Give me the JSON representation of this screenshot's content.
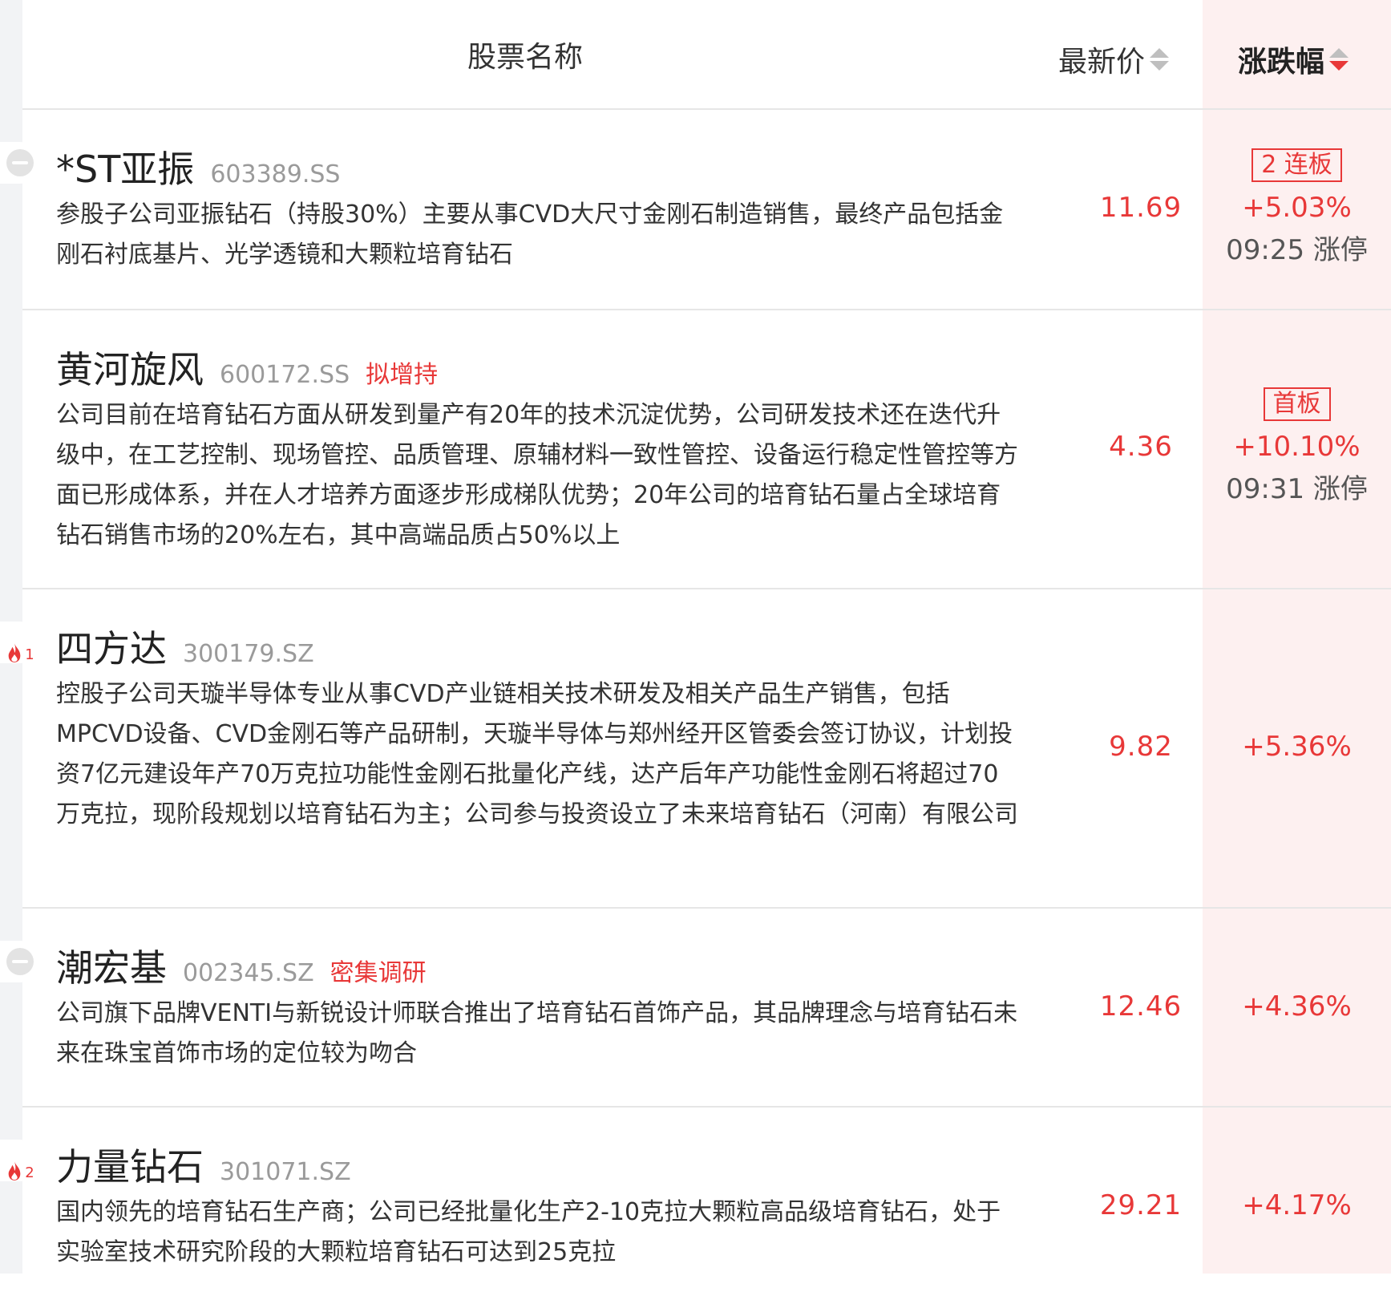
{
  "header": {
    "name_label": "股票名称",
    "price_label": "最新价",
    "pct_label": "涨跌幅",
    "sort_column": "涨跌幅",
    "sort_order": "descending"
  },
  "colors": {
    "up_red": "#e83838",
    "highlight_column_bg": "#fdf0f0",
    "muted_gray": "#9a9a9a"
  },
  "rows": [
    {
      "marker": "minus-icon",
      "name": "*ST亚振",
      "code": "603389.SS",
      "tag": "",
      "desc": "参股子公司亚振钻石（持股30%）主要从事CVD大尺寸金刚石制造销售，最终产品包括金刚石衬底基片、光学透镜和大颗粒培育钻石",
      "price": "11.69",
      "board": "2 连板",
      "pct": "+5.03%",
      "limit_time": "09:25 涨停"
    },
    {
      "marker": "",
      "name": "黄河旋风",
      "code": "600172.SS",
      "tag": "拟增持",
      "desc": "公司目前在培育钻石方面从研发到量产有20年的技术沉淀优势，公司研发技术还在迭代升级中，在工艺控制、现场管控、品质管理、原辅材料一致性管控、设备运行稳定性管控等方面已形成体系，并在人才培养方面逐步形成梯队优势；20年公司的培育钻石量占全球培育钻石销售市场的20%左右，其中高端品质占50%以上",
      "price": "4.36",
      "board": "首板",
      "pct": "+10.10%",
      "limit_time": "09:31 涨停"
    },
    {
      "marker": "fire-icon",
      "hot_rank": "1",
      "name": "四方达",
      "code": "300179.SZ",
      "tag": "",
      "desc": "控股子公司天璇半导体专业从事CVD产业链相关技术研发及相关产品生产销售，包括MPCVD设备、CVD金刚石等产品研制，天璇半导体与郑州经开区管委会签订协议，计划投资7亿元建设年产70万克拉功能性金刚石批量化产线，达产后年产功能性金刚石将超过70万克拉，现阶段规划以培育钻石为主；公司参与投资设立了未来培育钻石（河南）有限公司",
      "price": "9.82",
      "board": "",
      "pct": "+5.36%",
      "limit_time": ""
    },
    {
      "marker": "minus-icon",
      "name": "潮宏基",
      "code": "002345.SZ",
      "tag": "密集调研",
      "desc": "公司旗下品牌VENTI与新锐设计师联合推出了培育钻石首饰产品，其品牌理念与培育钻石未来在珠宝首饰市场的定位较为吻合",
      "price": "12.46",
      "board": "",
      "pct": "+4.36%",
      "limit_time": ""
    },
    {
      "marker": "fire-icon",
      "hot_rank": "2",
      "name": "力量钻石",
      "code": "301071.SZ",
      "tag": "",
      "desc": "国内领先的培育钻石生产商；公司已经批量化生产2-10克拉大颗粒高品级培育钻石，处于实验室技术研究阶段的大颗粒培育钻石可达到25克拉",
      "price": "29.21",
      "board": "",
      "pct": "+4.17%",
      "limit_time": ""
    }
  ]
}
